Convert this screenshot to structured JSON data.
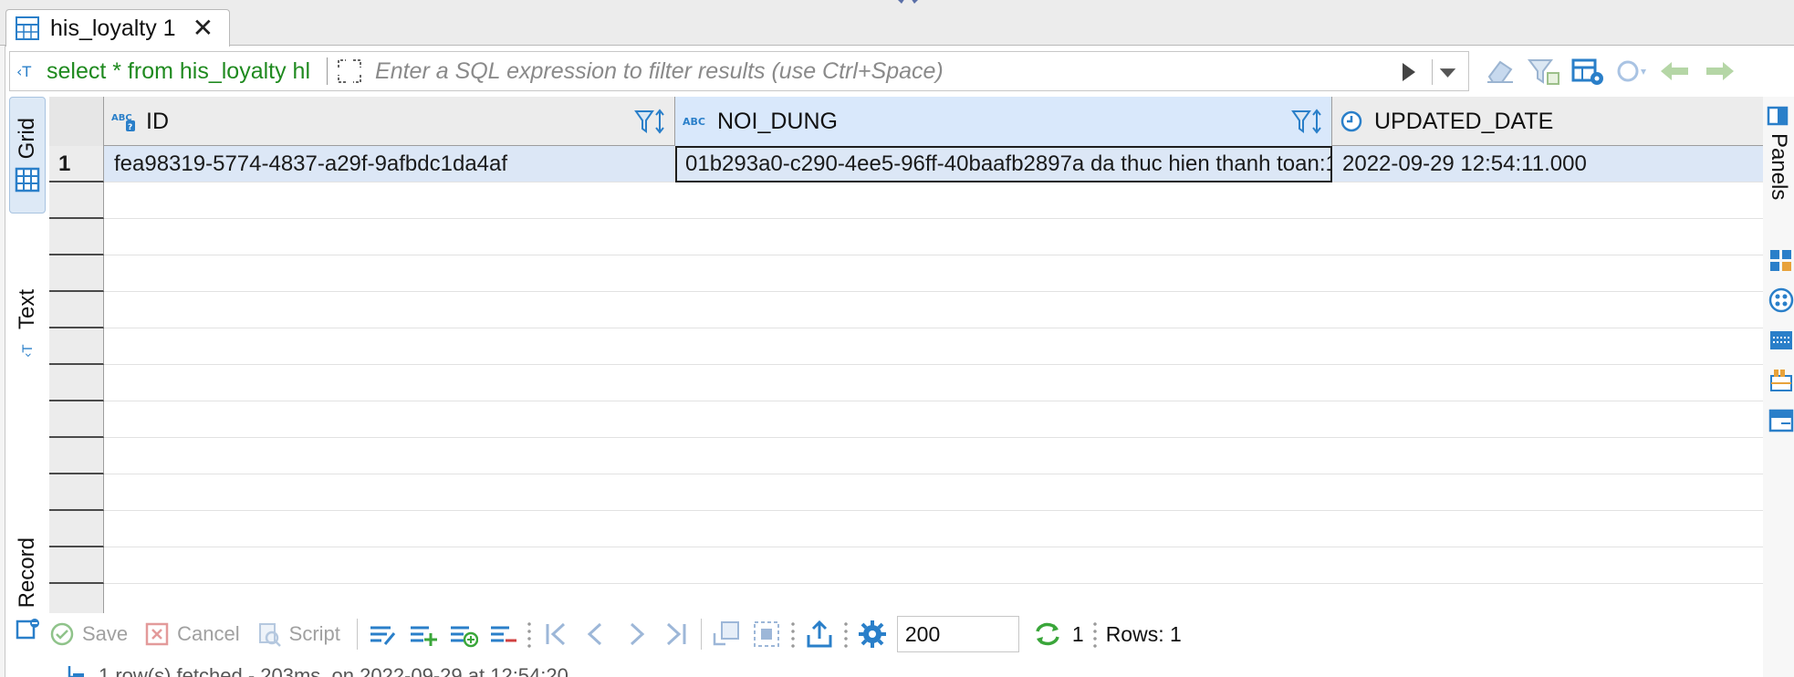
{
  "tab": {
    "label": "his_loyalty 1",
    "close": "✕"
  },
  "filter": {
    "query": "select * from his_loyalty hl",
    "placeholder": "Enter a SQL expression to filter results (use Ctrl+Space)"
  },
  "side_tabs": {
    "grid": "Grid",
    "text": "Text",
    "record": "Record"
  },
  "right_panel": {
    "label": "Panels"
  },
  "columns": [
    {
      "name": "ID",
      "type_icon": "abc-key-icon"
    },
    {
      "name": "NOI_DUNG",
      "type_icon": "abc-icon"
    },
    {
      "name": "UPDATED_DATE",
      "type_icon": "clock-icon"
    }
  ],
  "rows": [
    {
      "num": "1",
      "id": "fea98319-5774-4837-a29f-9afbdc1da4af",
      "noi_dung": "01b293a0-c290-4ee5-96ff-40baafb2897a da thuc hien thanh toan:1",
      "updated_date": "2022-09-29 12:54:11.000"
    }
  ],
  "toolbar": {
    "save": "Save",
    "cancel": "Cancel",
    "script": "Script",
    "fetch_size": "200",
    "refresh_count": "1",
    "rows": "Rows: 1"
  },
  "status": {
    "text": "1 row(s) fetched - 203ms, on 2022-09-29 at 12:54:20"
  },
  "colors": {
    "accent": "#2a7fc9",
    "sql_green": "#1f8a1f",
    "selection": "#dce7f6"
  }
}
